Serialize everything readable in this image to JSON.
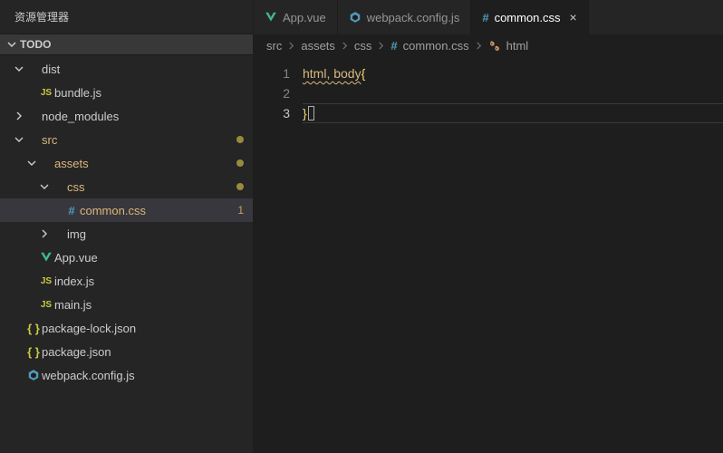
{
  "sidebar": {
    "title": "资源管理器",
    "section": "TODO",
    "tree": [
      {
        "label": "dist",
        "kind": "folder-open",
        "depth": 0,
        "twisty": "down",
        "modified": false
      },
      {
        "label": "bundle.js",
        "kind": "js",
        "depth": 1,
        "twisty": "",
        "modified": false
      },
      {
        "label": "node_modules",
        "kind": "folder",
        "depth": 0,
        "twisty": "right",
        "modified": false
      },
      {
        "label": "src",
        "kind": "folder-open",
        "depth": 0,
        "twisty": "down",
        "modified": true,
        "modcolor": true
      },
      {
        "label": "assets",
        "kind": "folder-open",
        "depth": 1,
        "twisty": "down",
        "modified": true,
        "modcolor": true
      },
      {
        "label": "css",
        "kind": "folder-open",
        "depth": 2,
        "twisty": "down",
        "modified": true,
        "modcolor": true
      },
      {
        "label": "common.css",
        "kind": "hash",
        "depth": 3,
        "twisty": "",
        "modified": false,
        "active": true,
        "badge": "1",
        "modcolor": true
      },
      {
        "label": "img",
        "kind": "folder",
        "depth": 2,
        "twisty": "right",
        "modified": false
      },
      {
        "label": "App.vue",
        "kind": "vue",
        "depth": 1,
        "twisty": "",
        "modified": false
      },
      {
        "label": "index.js",
        "kind": "js",
        "depth": 1,
        "twisty": "",
        "modified": false
      },
      {
        "label": "main.js",
        "kind": "js",
        "depth": 1,
        "twisty": "",
        "modified": false
      },
      {
        "label": "package-lock.json",
        "kind": "braces",
        "depth": 0,
        "twisty": "",
        "modified": false
      },
      {
        "label": "package.json",
        "kind": "braces",
        "depth": 0,
        "twisty": "",
        "modified": false
      },
      {
        "label": "webpack.config.js",
        "kind": "webpack",
        "depth": 0,
        "twisty": "",
        "modified": false
      }
    ]
  },
  "tabs": [
    {
      "label": "App.vue",
      "icon": "vue",
      "active": false
    },
    {
      "label": "webpack.config.js",
      "icon": "webpack",
      "active": false
    },
    {
      "label": "common.css",
      "icon": "hash",
      "active": true,
      "close": "×"
    }
  ],
  "breadcrumbs": [
    {
      "label": "src",
      "icon": ""
    },
    {
      "label": "assets",
      "icon": ""
    },
    {
      "label": "css",
      "icon": ""
    },
    {
      "label": "common.css",
      "icon": "hash"
    },
    {
      "label": "html",
      "icon": "symbol"
    }
  ],
  "editor": {
    "lines": [
      "1",
      "2",
      "3"
    ],
    "code": {
      "l1_selector": "html, body",
      "l1_brace": "{",
      "l3_brace": "}"
    }
  }
}
